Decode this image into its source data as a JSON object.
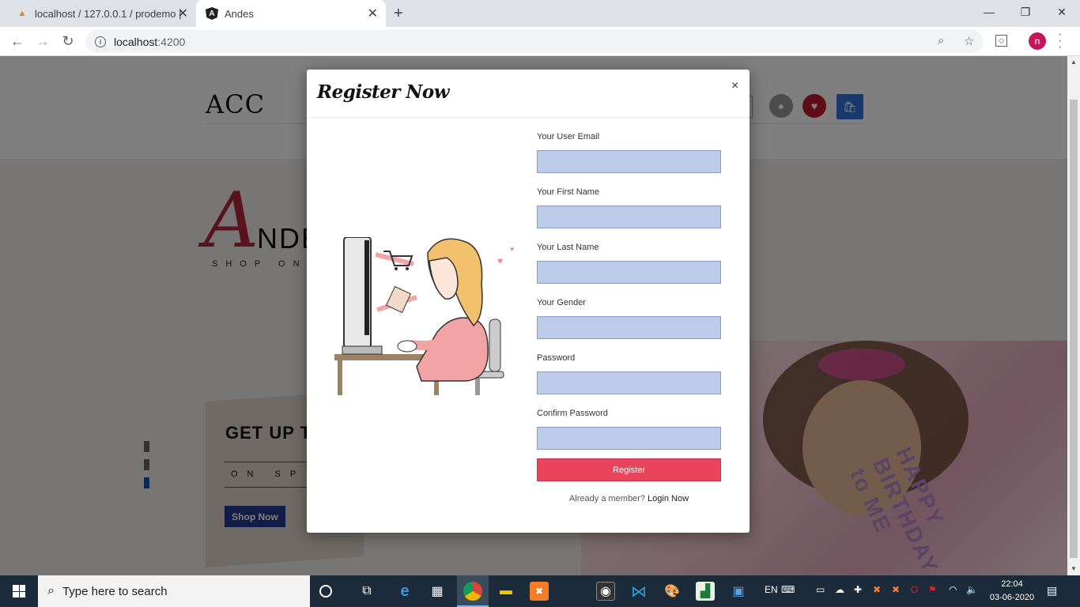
{
  "browser": {
    "tabs": [
      {
        "title": "localhost / 127.0.0.1 / prodemo |",
        "icon": "phpmyadmin-icon"
      },
      {
        "title": "Andes",
        "icon": "angular-icon"
      }
    ],
    "url_host": "localhost",
    "url_port": ":4200",
    "profile_initial": "n"
  },
  "page": {
    "logo": "ACC",
    "brand_letter": "A",
    "brand_rest": "NDE",
    "brand_tagline": "SHOP ON",
    "promo_title": "GET UP T",
    "promo_sub": "ON SP",
    "shop_now": "Shop Now",
    "shirt_text": "HAPPY BIRTHDAY to ME"
  },
  "modal": {
    "title": "Register Now",
    "close": "×",
    "fields": [
      {
        "label": "Your User Email",
        "value": ""
      },
      {
        "label": "Your First Name",
        "value": ""
      },
      {
        "label": "Your Last Name",
        "value": ""
      },
      {
        "label": "Your Gender",
        "value": ""
      },
      {
        "label": "Password",
        "value": ""
      },
      {
        "label": "Confirm Password",
        "value": ""
      }
    ],
    "register_label": "Register",
    "already_text": "Already a member?",
    "login_link": "Login Now"
  },
  "taskbar": {
    "search_placeholder": "Type here to search",
    "lang": "EN",
    "time": "22:04",
    "date": "03-06-2020"
  },
  "colors": {
    "accent": "#e8445b",
    "input_bg": "#bccbe8",
    "brand_red": "#b3263a",
    "shop_now_bg": "#233b8c"
  }
}
